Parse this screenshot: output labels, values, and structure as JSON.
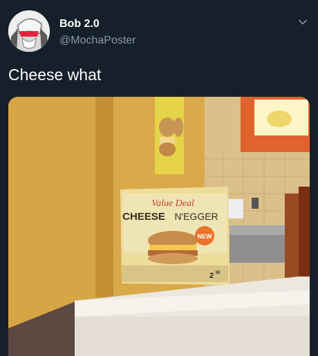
{
  "tweet": {
    "author": {
      "display_name": "Bob 2.0",
      "handle": "@MochaPoster",
      "avatar_icon": "anime-character-avatar"
    },
    "text": "Cheese what",
    "menu_icon": "chevron-down-icon"
  },
  "photo": {
    "sign_script": "Value Deal",
    "sign_title_bold": "CHEESE",
    "sign_title_rest": "N'EGGER",
    "badge": "NEW",
    "price": "2",
    "price_cents": "50"
  },
  "colors": {
    "background": "#15202b",
    "secondary_text": "#8899a6",
    "badge": "#e8732a"
  }
}
